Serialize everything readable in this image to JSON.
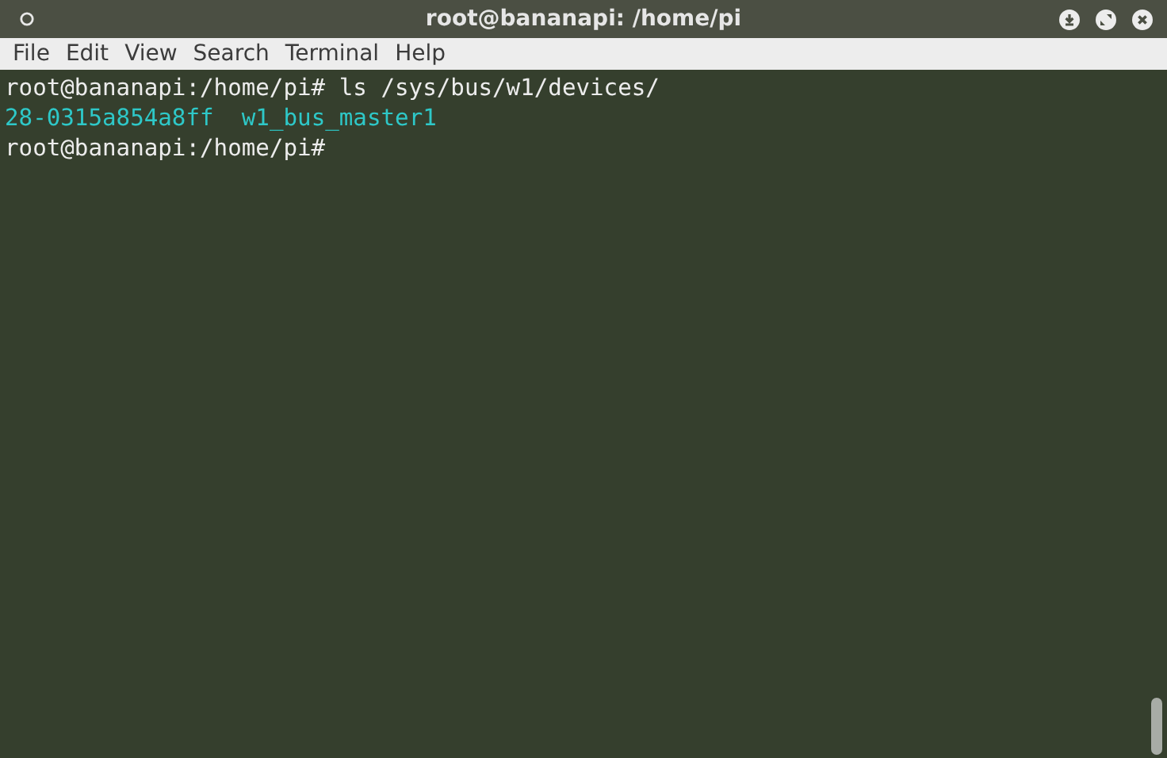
{
  "window": {
    "title": "root@bananapi: /home/pi"
  },
  "menu": [
    "File",
    "Edit",
    "View",
    "Search",
    "Terminal",
    "Help"
  ],
  "lines": [
    {
      "kind": "command",
      "items": [
        "root@bananapi:/home/pi# ls /sys/bus/w1/devices/"
      ]
    },
    {
      "kind": "listing",
      "items": [
        "28-0315a854a8ff",
        "w1_bus_master1"
      ]
    },
    {
      "kind": "command",
      "items": [
        "root@bananapi:/home/pi#"
      ]
    }
  ]
}
